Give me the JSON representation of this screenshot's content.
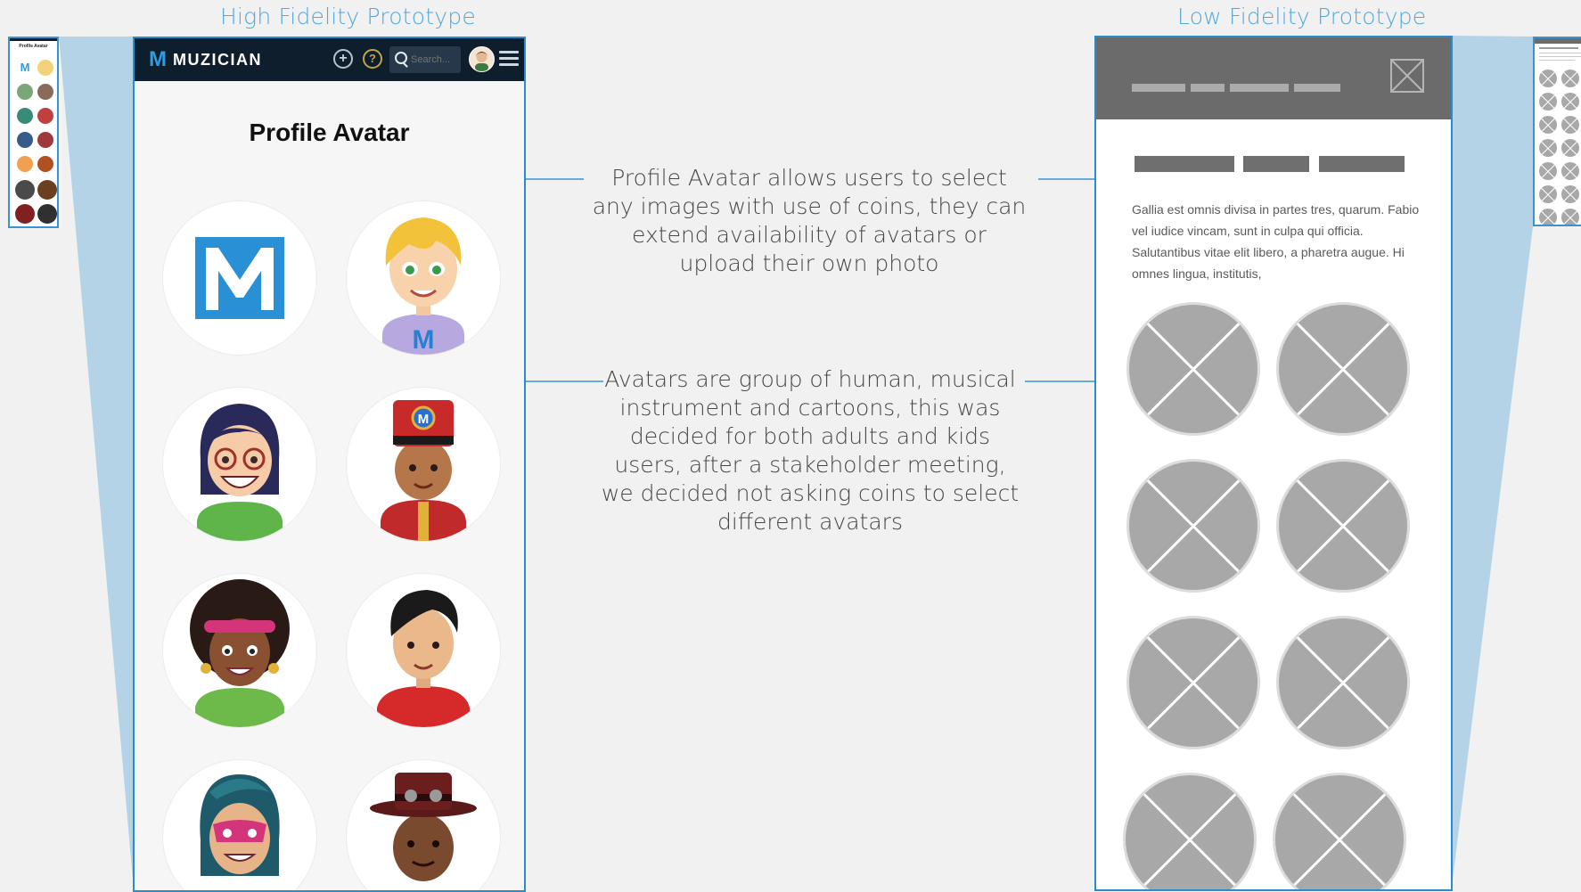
{
  "headings": {
    "high": "High Fidelity Prototype",
    "low": "Low Fidelity Prototype"
  },
  "hi_fi": {
    "brand_letter": "M",
    "brand_name": "MUZICIAN",
    "add_glyph": "+",
    "help_glyph": "?",
    "search_placeholder": "Search...",
    "page_title": "Profile Avatar",
    "avatar_badge": "M",
    "avatars": [
      "muzician-logo-avatar",
      "blond-boy-avatar",
      "girl-with-glasses-avatar",
      "drummer-boy-avatar",
      "afro-girl-avatar",
      "boy-red-shirt-avatar",
      "superhero-girl-avatar",
      "man-with-hat-avatar"
    ]
  },
  "notes": {
    "profile_avatar": "Profile Avatar allows users to select any images with use of coins, they can extend availability of avatars or upload their own photo",
    "avatars_group": "Avatars are group of human, musical instrument and cartoons, this was decided for both adults and kids users, after a stakeholder meeting, we decided not asking coins to select different avatars"
  },
  "lo_fi": {
    "body_text": "Gallia est omnis divisa in partes tres, quarum. Fabio vel iudice vincam, sunt in culpa qui officia. Salutantibus vitae elit libero, a pharetra augue. Hi omnes lingua, institutis,",
    "placeholder_icon": "image-placeholder-icon"
  },
  "thumbnails": {
    "left_title": "Profile Avatar"
  },
  "colors": {
    "accent": "#52a8dd",
    "frame_border": "#2a8ccb",
    "nav_bg": "#0e1e2d",
    "brand_blue": "#2f9be0",
    "projection": "#b5d3e7"
  }
}
